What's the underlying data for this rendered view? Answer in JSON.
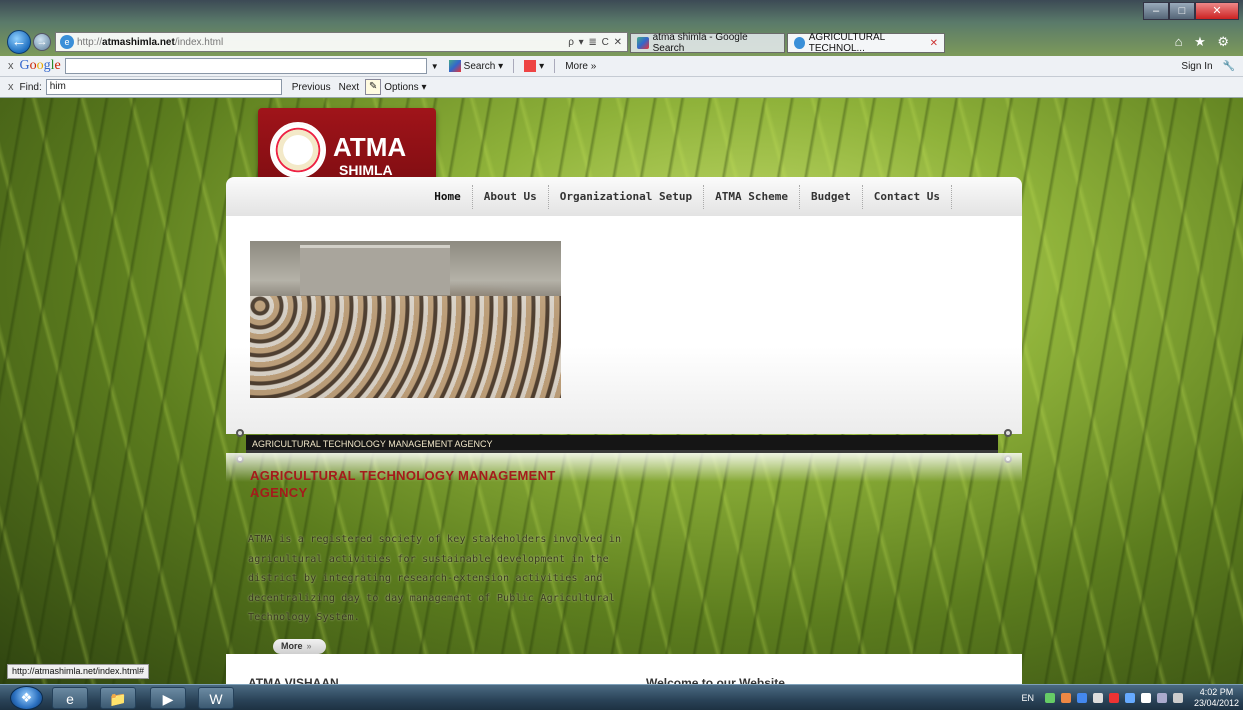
{
  "browser": {
    "url_prefix": "http://",
    "url_domain": "atmashimla.net",
    "url_path": "/index.html",
    "address_tools": "ρ ▾ ≣ C ✕",
    "tabs": [
      {
        "label": "atma shimla - Google Search",
        "icon": "google-icon"
      },
      {
        "label": "AGRICULTURAL TECHNOL...",
        "icon": "ie-page-icon",
        "close": "✕"
      }
    ],
    "window": {
      "minimize": "–",
      "maximize": "□",
      "close": "✕"
    },
    "right_icons": "⌂ ★ ⚙"
  },
  "google_toolbar": {
    "close": "x",
    "logo": [
      "G",
      "o",
      "o",
      "g",
      "l",
      "e"
    ],
    "search_label": "Search",
    "more_label": "More »",
    "signin_label": "Sign In"
  },
  "find_bar": {
    "close": "x",
    "label": "Find:",
    "value": "him",
    "previous": "Previous",
    "next": "Next",
    "options": "Options"
  },
  "site": {
    "logo_title": "ATMA",
    "logo_subtitle": "SHIMLA",
    "nav": [
      "Home",
      "About Us",
      "Organizational Setup",
      "ATMA Scheme",
      "Budget",
      "Contact Us"
    ],
    "slide_caption": "AGRICULTURAL TECHNOLOGY MANAGEMENT AGENCY",
    "heading": "AGRICULTURAL TECHNOLOGY MANAGEMENT AGENCY",
    "intro": "ATMA is a registered society of key stakeholders involved in agricultural activities for sustainable development in the district by integrating research-extension activities and decentralizing day to day management of Public Agricultural Technology System.",
    "more_label": "More",
    "more_arrow": "»",
    "bottom_left": "ATMA VISHAAN",
    "bottom_right": "Welcome to our Website"
  },
  "status_bar": {
    "url": "http://atmashimla.net/index.html#"
  },
  "taskbar": {
    "language": "EN",
    "time": "4:02 PM",
    "date": "23/04/2012"
  }
}
